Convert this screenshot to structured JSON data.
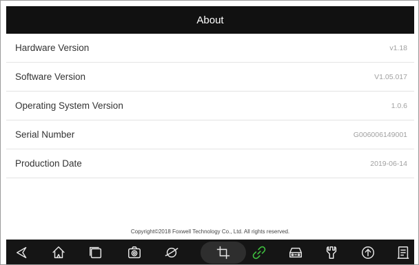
{
  "header": {
    "title": "About"
  },
  "rows": [
    {
      "label": "Hardware Version",
      "value": "v1.18"
    },
    {
      "label": "Software Version",
      "value": "V1.05.017"
    },
    {
      "label": "Operating System Version",
      "value": "1.0.6"
    },
    {
      "label": "Serial Number",
      "value": "G006006149001"
    },
    {
      "label": "Production Date",
      "value": "2019-06-14"
    }
  ],
  "footer": {
    "copyright": "Copyright©2018 Foxwell Technology Co., Ltd. All rights reserved."
  },
  "navbar": {
    "icons": [
      "back-icon",
      "home-icon",
      "recent-apps-icon",
      "camera-icon",
      "browser-icon",
      "crop-icon",
      "link-icon",
      "car-icon",
      "wrench-icon",
      "upload-icon",
      "report-icon"
    ]
  },
  "colors": {
    "header_bg": "#111111",
    "navbar_bg": "#151515",
    "accent_green": "#3fbf3f",
    "icon_stroke": "#e6e6e6"
  }
}
